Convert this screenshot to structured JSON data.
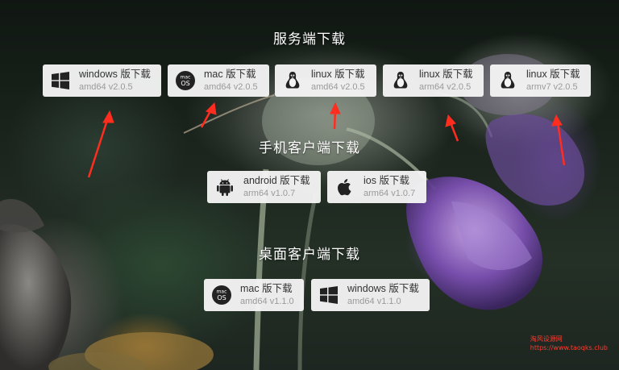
{
  "sections": [
    {
      "title": "服务端下载",
      "buttons": [
        {
          "icon": "windows-icon",
          "name": "windows 版下载",
          "version": "amd64 v2.0.5"
        },
        {
          "icon": "macos-icon",
          "name": "mac 版下载",
          "version": "amd64 v2.0.5"
        },
        {
          "icon": "linux-icon",
          "name": "linux 版下载",
          "version": "amd64 v2.0.5"
        },
        {
          "icon": "linux-icon",
          "name": "linux 版下载",
          "version": "arm64 v2.0.5"
        },
        {
          "icon": "linux-icon",
          "name": "linux 版下载",
          "version": "armv7 v2.0.5"
        }
      ]
    },
    {
      "title": "手机客户端下载",
      "buttons": [
        {
          "icon": "android-icon",
          "name": "android 版下载",
          "version": "arm64 v1.0.7"
        },
        {
          "icon": "apple-icon",
          "name": "ios 版下载",
          "version": "arm64 v1.0.7"
        }
      ]
    },
    {
      "title": "桌面客户端下载",
      "buttons": [
        {
          "icon": "macos-icon",
          "name": "mac 版下载",
          "version": "amd64 v1.1.0"
        },
        {
          "icon": "windows-icon",
          "name": "windows 版下载",
          "version": "amd64 v1.1.0"
        }
      ]
    }
  ],
  "watermark": {
    "line1": "淘风设源网",
    "line2": "https://www.taoqks.club"
  },
  "colors": {
    "button_bg": "#f4f4f4",
    "arrow": "#ff3b30"
  }
}
